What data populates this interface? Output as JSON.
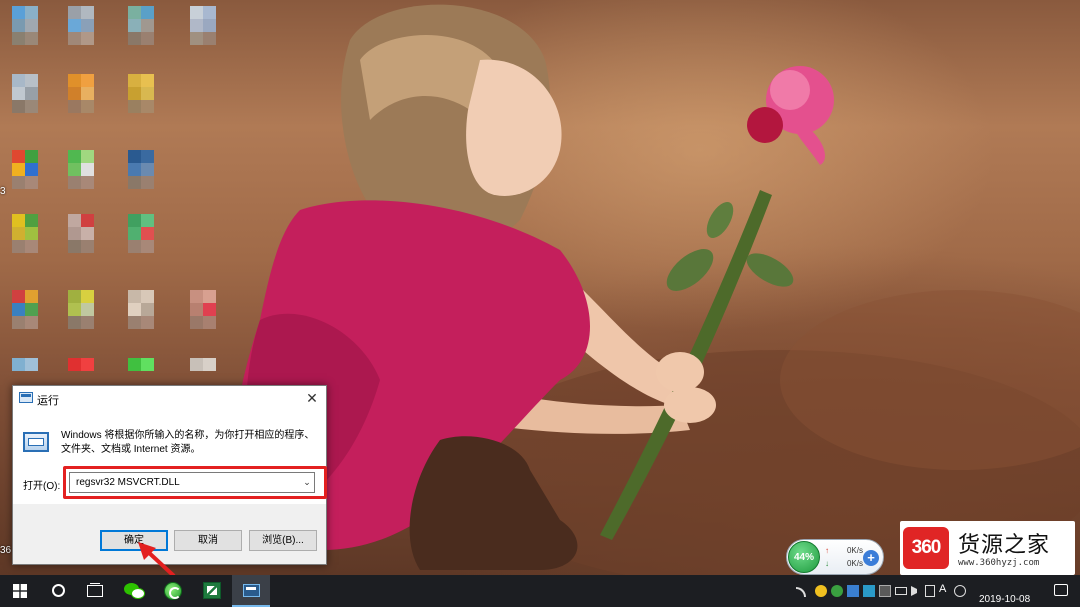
{
  "desktop": {
    "left_edge_labels": [
      "3",
      "36"
    ]
  },
  "run_dialog": {
    "title": "运行",
    "close_glyph": "✕",
    "description_line1": "Windows 将根据你所输入的名称，为你打开相应的程序、",
    "description_line2": "文件夹、文档或 Internet 资源。",
    "open_label": "打开(O):",
    "input_value": "regsvr32 MSVCRT.DLL",
    "dropdown_glyph": "⌄",
    "ok_label": "确定",
    "cancel_label": "取消",
    "browse_label": "浏览(B)...",
    "highlight_color": "#e32020"
  },
  "network_widget": {
    "percent": "44%",
    "upload_arrow": "↑",
    "upload_value": "0K/s",
    "download_arrow": "↓",
    "download_value": "0K/s",
    "plus": "+"
  },
  "watermark": {
    "logo": "360",
    "name": "货源之家",
    "url": "www.360hyzj.com"
  },
  "taskbar": {
    "icons": [
      "windows-start-icon",
      "search-icon",
      "task-view-icon",
      "wechat-icon",
      "360-security-icon",
      "excel-icon",
      "run-icon"
    ],
    "ime_indicator": "A",
    "date": "2019-10-08",
    "accent_color": "#76b9ed"
  }
}
